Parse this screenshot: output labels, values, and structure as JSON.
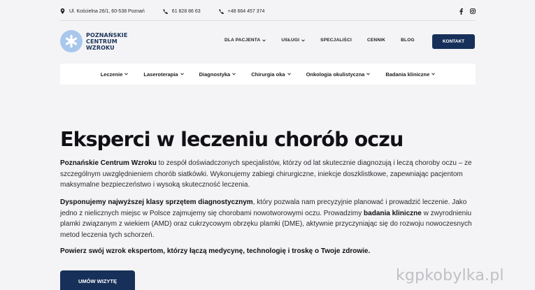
{
  "topbar": {
    "address": "Ul. Kościelna 26/1, 60-538 Poznań",
    "phone1": "61 828 86 63",
    "phone2": "+48 664 457 374",
    "social_icons": [
      "facebook-icon",
      "instagram-icon"
    ]
  },
  "logo": {
    "line1": "POZNAŃSKIE",
    "line2": "CENTRUM",
    "line3": "WZROKU"
  },
  "main_nav": {
    "items": [
      {
        "label": "DLA PACJENTA",
        "dropdown": true
      },
      {
        "label": "USŁUGI",
        "dropdown": true
      },
      {
        "label": "SPECJALIŚCI",
        "dropdown": false
      },
      {
        "label": "CENNIK",
        "dropdown": false
      },
      {
        "label": "BLOG",
        "dropdown": false
      }
    ],
    "contact_label": "KONTAKT"
  },
  "sub_nav": {
    "items": [
      {
        "label": "Leczenie"
      },
      {
        "label": "Laseroterapia"
      },
      {
        "label": "Diagnostyka"
      },
      {
        "label": "Chirurgia oka"
      },
      {
        "label": "Onkologia okulistyczna"
      },
      {
        "label": "Badania kliniczne"
      }
    ]
  },
  "hero": {
    "title": "Eksperci w leczeniu chorób oczu",
    "p1_bold": "Poznańskie Centrum Wzroku",
    "p1_rest": " to zespół doświadczonych specjalistów, którzy od lat skutecznie diagnozują i leczą choroby oczu – ze szczególnym uwzględnieniem chorób siatkówki. Wykonujemy zabiegi chirurgiczne, iniekcje doszklistkowe, zapewniając pacjentom maksymalne bezpieczeństwo i wysoką skuteczność leczenia.",
    "p2_bold1": "Dysponujemy najwyższej klasy sprzętem diagnostycznym",
    "p2_mid": ", który pozwala nam precyzyjnie planować i prowadzić leczenie. Jako jedno z nielicznych miejsc w Polsce zajmujemy się chorobami nowotworowymi oczu. Prowadzimy ",
    "p2_bold2": "badania kliniczne",
    "p2_end": " w zwyrodnieniu plamki związanym z wiekiem (AMD) oraz cukrzycowym obrzęku plamki (DME), aktywnie przyczyniając się do rozwoju nowoczesnych metod leczenia tych schorzeń.",
    "p3": "Powierz swój wzrok ekspertom, którzy łączą medycynę, technologię i troskę o Twoje zdrowie.",
    "cta_label": "UMÓW WIZYTĘ"
  },
  "watermark": "kgpkobylka.pl",
  "colors": {
    "brand_navy": "#17305a",
    "logo_light_blue": "#a9c7ec",
    "background": "#f4f4f6"
  }
}
